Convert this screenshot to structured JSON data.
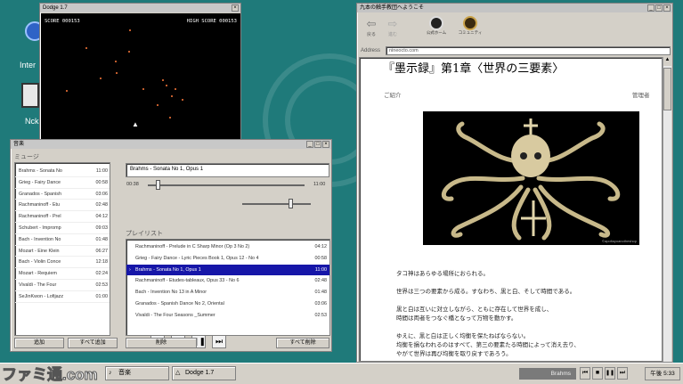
{
  "desktop": {
    "icons": [
      {
        "label": "Inter",
        "icon": "globe-icon"
      },
      {
        "label": "Nck",
        "icon": "ghost-icon"
      }
    ]
  },
  "dodge": {
    "title": "Dodge 1.7",
    "score": "SCORE 000153",
    "high_score": "HIGH SCORE 000153"
  },
  "music": {
    "title": "音楽",
    "library_header": "ミュージ",
    "library": [
      {
        "title": "Brahms - Sonata No",
        "time": "11:00"
      },
      {
        "title": "Grieg - Fairy Dance",
        "time": "00:58"
      },
      {
        "title": "Granados - Spanish",
        "time": "03:06"
      },
      {
        "title": "Rachmaninoff - Etu",
        "time": "02:48"
      },
      {
        "title": "Rachmaninoff - Prel",
        "time": "04:12"
      },
      {
        "title": "Schubert - Impromp",
        "time": "09:03"
      },
      {
        "title": "Bach - Invention No",
        "time": "01:48"
      },
      {
        "title": "Mozart - Eine Klein",
        "time": "06:27"
      },
      {
        "title": "Bach - Violin Conce",
        "time": "12:18"
      },
      {
        "title": "Mozart - Requiem",
        "time": "02:24"
      },
      {
        "title": "Vivaldi - The Four",
        "time": "02:53"
      },
      {
        "title": "SeJinKwon - Lofijazz",
        "time": "01:00"
      }
    ],
    "add_label": "追加",
    "add_all_label": "すべて追加",
    "now_playing": "Brahms - Sonata No 1, Opus 1",
    "elapsed": "00:38",
    "total": "11:00",
    "progress": 0.06,
    "volume": 0.7,
    "playlist_header": "プレイリスト",
    "playlist": [
      {
        "title": "Rachmaninoff - Prelude in C Sharp Minor (Op 3 No 2)",
        "time": "04:12",
        "selected": false
      },
      {
        "title": "Grieg - Fairy Dance - Lyric Pieces Book 1, Opus 12 - No 4",
        "time": "00:58",
        "selected": false
      },
      {
        "title": "Brahms - Sonata No 1, Opus 1",
        "time": "11:00",
        "selected": true
      },
      {
        "title": "Rachmaninoff - Etudes-tableaux, Opus 33 - No 6",
        "time": "02:48",
        "selected": false
      },
      {
        "title": "Bach - Invention No 13 in A Minor",
        "time": "01:48",
        "selected": false
      },
      {
        "title": "Granados - Spanish Dance No 2, Oriental",
        "time": "03:06",
        "selected": false
      },
      {
        "title": "Vivaldi - The Four Seasons _Summer",
        "time": "02:53",
        "selected": false
      }
    ],
    "delete_label": "削除",
    "delete_all_label": "すべて削除"
  },
  "browser": {
    "title": "九本の触手教団へようこそ",
    "back_label": "戻る",
    "forward_label": "進む",
    "home_label": "公式ホーム",
    "community_label": "コミュニティ",
    "address_label": "Address",
    "address_value": "nineocto.com",
    "heading": "『墨示録』第1章〈世界の三要素〉",
    "intro_label": "ご紹介",
    "admin_label": "管理者",
    "image_credit": "©apoltayoanotheshop",
    "paragraphs": [
      [
        "タコ神はあらゆる場所におられる。"
      ],
      [
        "世界は三つの要素から成る。すなわち、黒と白、そして時間である。"
      ],
      [
        "黒と白は互いに対立しながら、ともに存在して世界を成し、",
        "時間は両者をつなぐ橋となって万物を動かす。"
      ],
      [
        "ゆえに、黒と白は正しく均衡を保たねばならない。",
        "均衡を損なわれるのはすべて、第三の要素たる時間によって消え去り、",
        "やがて世界は再び均衡を取り戻すであろう。"
      ]
    ]
  },
  "taskbar": {
    "watermark": "ファミ通.com",
    "tasks": [
      {
        "label": "音楽",
        "icon": "music-icon"
      },
      {
        "label": "Dodge 1.7",
        "icon": "triangle-icon"
      }
    ],
    "now_playing": "Brahms",
    "clock": "午後 5:33"
  }
}
